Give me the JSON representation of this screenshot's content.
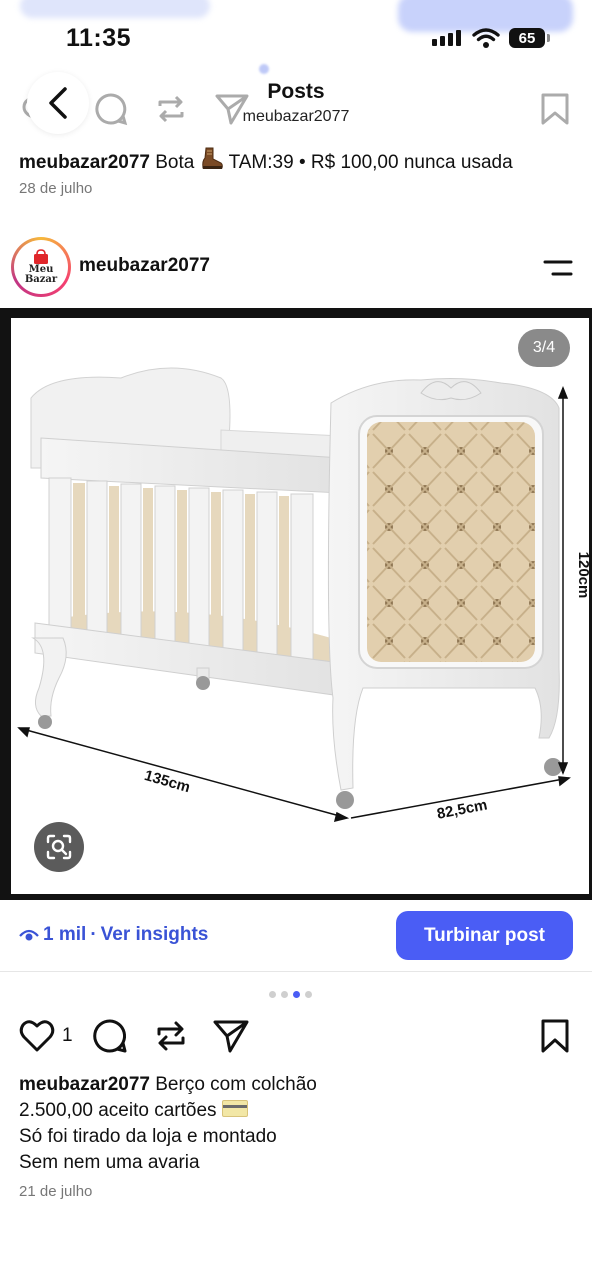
{
  "status_bar": {
    "time": "11:35",
    "battery": "65"
  },
  "header": {
    "title": "Posts",
    "subtitle": "meubazar2077"
  },
  "previous_post": {
    "username": "meubazar2077",
    "caption_before_emoji": "Bota",
    "emoji": "boot",
    "caption_after_emoji": "TAM:39 • R$ 100,00 nunca usada",
    "date": "28 de julho"
  },
  "post": {
    "username": "meubazar2077",
    "avatar_lines": [
      "Meu",
      "Bazar"
    ],
    "image_counter": "3/4",
    "image": {
      "subject": "white crib with tufted beige headboard",
      "dimension_labels": [
        "120cm",
        "135cm",
        "82,5cm"
      ]
    },
    "views": "1 mil",
    "separator": "·",
    "insights_label": "Ver insights",
    "boost_label": "Turbinar post",
    "carousel": {
      "total": 4,
      "active_index": 2
    },
    "likes": "1",
    "caption": {
      "username": "meubazar2077",
      "line1_text": "Berço com colchão",
      "line2_text": "2.500,00 aceito cartões",
      "line3_text": "Só foi tirado da loja e montado",
      "line4_text": "Sem nem uma avaria"
    },
    "date": "21 de julho"
  },
  "colors": {
    "accent": "#4a5df5",
    "link": "#3a53d6",
    "muted": "#777777"
  }
}
